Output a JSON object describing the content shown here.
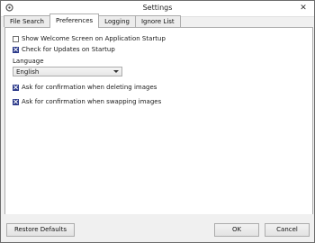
{
  "window": {
    "title": "Settings"
  },
  "tabs": [
    {
      "label": "File Search"
    },
    {
      "label": "Preferences"
    },
    {
      "label": "Logging"
    },
    {
      "label": "Ignore List"
    }
  ],
  "active_tab": "Preferences",
  "preferences": {
    "show_welcome": {
      "label": "Show Welcome Screen on Application Startup",
      "checked": false
    },
    "check_updates": {
      "label": "Check for Updates on Startup",
      "checked": true
    },
    "language_label": "Language",
    "language_value": "English",
    "confirm_delete": {
      "label": "Ask for confirmation when deleting images",
      "checked": true
    },
    "confirm_swap": {
      "label": "Ask for confirmation when swapping images",
      "checked": true
    }
  },
  "buttons": {
    "restore": "Restore Defaults",
    "ok": "OK",
    "cancel": "Cancel"
  },
  "icons": {
    "app": "settings-app-icon",
    "close": "close-icon"
  }
}
